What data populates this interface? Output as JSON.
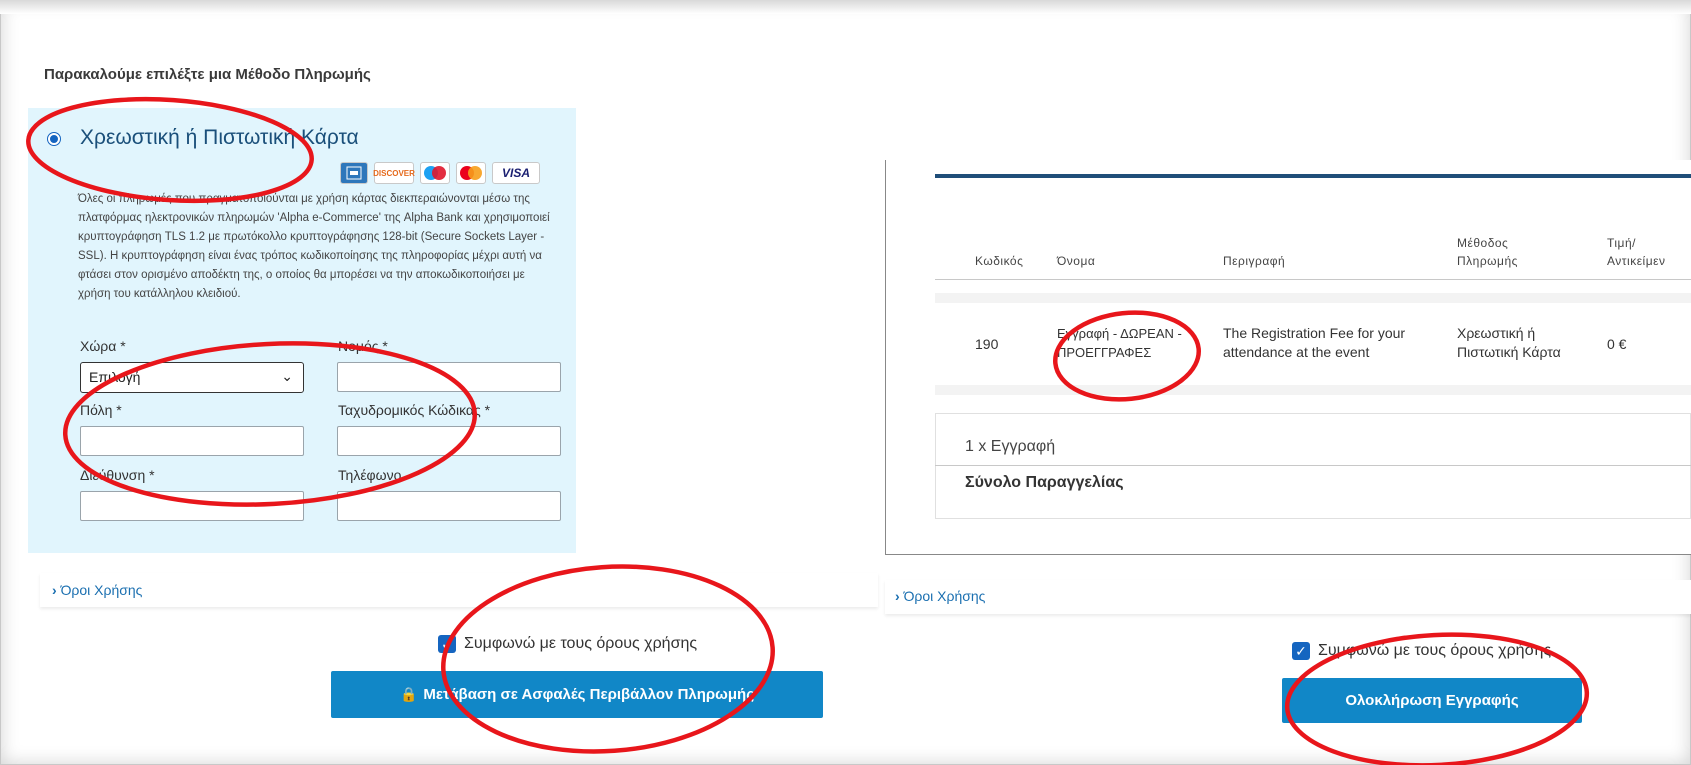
{
  "left": {
    "prompt": "Παρακαλούμε επιλέξτε μια Μέθοδο Πληρωμής",
    "method_title": "Χρεωστική ή Πιστωτική Κάρτα",
    "cards": {
      "amex": "",
      "discover": "DISCOVER",
      "visa": "VISA"
    },
    "description": "Όλες οι πληρωμές που πραγματοποιούνται με χρήση κάρτας διεκπεραιώνονται μέσω της πλατφόρμας ηλεκτρονικών πληρωμών 'Alpha e-Commerce' της Alpha Bank και χρησιμοποιεί κρυπτογράφηση TLS 1.2 με πρωτόκολλο κρυπτογράφησης 128-bit (Secure Sockets Layer - SSL). Η κρυπτογράφηση είναι ένας τρόπος κωδικοποίησης της πληροφορίας μέχρι αυτή να φτάσει στον ορισμένο αποδέκτη της, ο οποίος θα μπορέσει να την αποκωδικοποιήσει με χρήση του κατάλληλου κλειδιού.",
    "labels": {
      "country": "Χώρα *",
      "county": "Νομός *",
      "city": "Πόλη *",
      "postal": "Ταχυδρομικός Κώδικας *",
      "address": "Διεύθυνση *",
      "phone": "Τηλέφωνο"
    },
    "country_value": "Επιλογή",
    "terms": "Όροι Χρήσης",
    "agree": "Συμφωνώ με τους όρους χρήσης",
    "button": "Μετάβαση σε Ασφαλές Περιβάλλον Πληρωμής"
  },
  "right": {
    "headers": {
      "code": "Κωδικός",
      "name": "Όνομα",
      "description": "Περιγραφή",
      "method": "Μέθοδος Πληρωμής",
      "price": "Τιμή/ Αντικείμεν"
    },
    "row": {
      "code": "190",
      "name": "Εγγραφή - ΔΩΡΕΑΝ - ΠΡΟΕΓΓΡΑΦΕΣ",
      "description": "The Registration Fee for your attendance at the event",
      "method": "Χρεωστική ή Πιστωτική Κάρτα",
      "price": "0 €"
    },
    "count": "1 x Εγγραφή",
    "total_label": "Σύνολο Παραγγελίας",
    "terms": "Όροι Χρήσης",
    "agree": "Συμφωνώ με τους όρους χρήσης",
    "button": "Ολοκλήρωση Εγγραφής"
  },
  "colors": {
    "accent_button": "#1187c7",
    "annotation_red": "#e8161b",
    "panel_bg": "#e1f5fd"
  }
}
